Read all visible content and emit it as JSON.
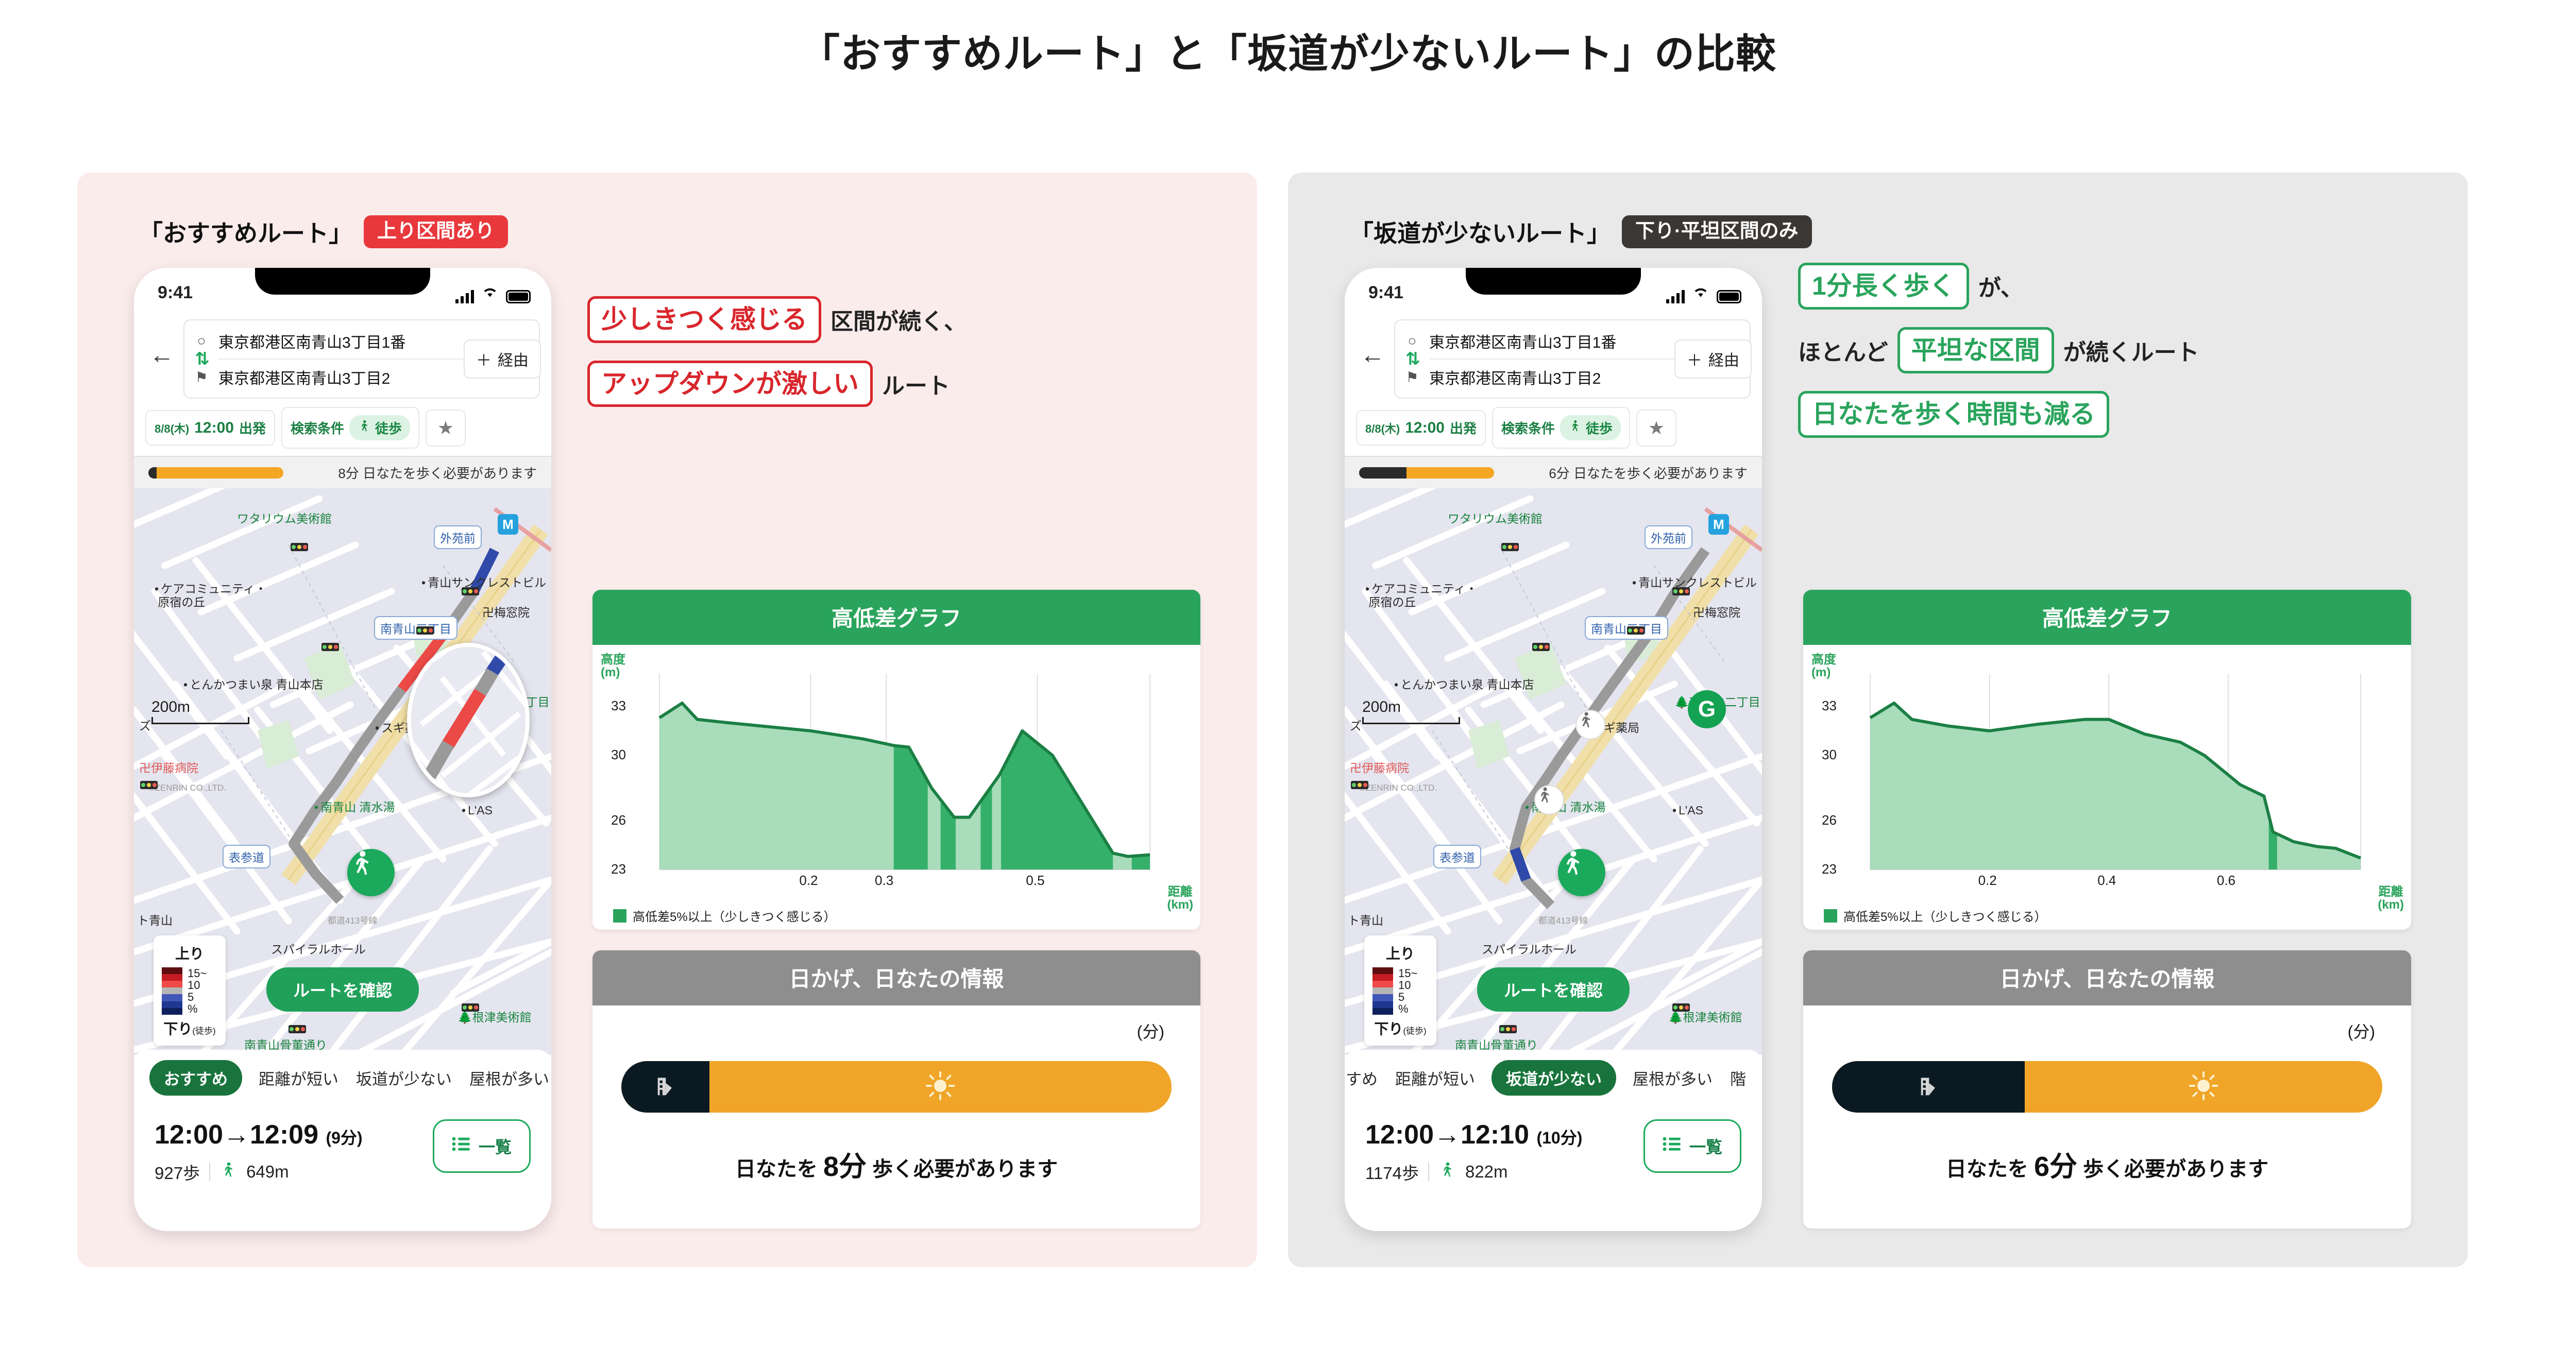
{
  "page_title": "「おすすめルート」と「坂道が少ないルート」の比較",
  "panels": [
    {
      "route_name": "「おすすめルート」",
      "badge": "上り区間あり",
      "badge_color": "#e8383c",
      "phone": {
        "clock": "9:41",
        "origin": "東京都港区南青山3丁目1番",
        "destination": "東京都港区南青山3丁目2",
        "via_label": "経由",
        "depart_date": "8/8(木)",
        "depart_time": "12:00",
        "depart_suffix": "出発",
        "search_cond_label": "検索条件",
        "mode_label": "徒歩",
        "sun_strip_text": "8分 日なたを歩く必要があります",
        "sun_strip_shade_pct": 6,
        "scale_label": "200m",
        "confirm_button": "ルートを確認",
        "map_labels": [
          "ワタリウム美術館",
          "外苑前",
          "青山サンクレストビル",
          "梅窓院",
          "ケアコミュニティ・",
          "原宿の丘",
          "南青山三丁目",
          "とんかつまい泉 青山本店",
          "スギ薬局",
          "南青山 清水湯",
          "伊藤病院",
          "表参道",
          "スパイラルホール",
          "ト青山",
          "南青山骨董通り",
          "根津美術館",
          "L'AS",
          "ズ",
          "©ZENRIN CO.,LTD.",
          "都道413号線",
          "南青山二丁目"
        ],
        "slope_legend": {
          "up": "上り",
          "down": "下り",
          "down_note": "(徒歩)",
          "ticks": [
            "15~",
            "10",
            "5",
            "%"
          ],
          "colors": [
            "#5e0d11",
            "#c41c22",
            "#ef4a47",
            "#b5b5b5",
            "#4157b8",
            "#1f3790",
            "#0d1f5c"
          ]
        },
        "tabs": [
          {
            "label": "おすすめ",
            "active": true
          },
          {
            "label": "距離が短い",
            "active": false
          },
          {
            "label": "坂道が少ない",
            "active": false
          },
          {
            "label": "屋根が多い",
            "active": false
          }
        ],
        "time_start": "12:00",
        "time_arrow": "→",
        "time_end": "12:09",
        "duration": "(9分)",
        "steps": "927歩",
        "distance": "649m",
        "list_button": "一覧"
      },
      "annotations": [
        {
          "highlight": "少しきつく感じる",
          "tail": "区間が続く、",
          "color": "red"
        },
        {
          "highlight": "アップダウンが激しい",
          "tail": "ルート",
          "color": "red"
        }
      ],
      "chart_card_title": "高低差グラフ",
      "sun_card_title": "日かげ、日なたの情報",
      "sun_unit": "(分)",
      "sun_shade_pct": 16,
      "sun_caption_pre": "日なたを",
      "sun_caption_value": "8分",
      "sun_caption_post": "歩く必要があります"
    },
    {
      "route_name": "「坂道が少ないルート」",
      "badge": "下り·平坦区間のみ",
      "badge_color": "#3b3734",
      "phone": {
        "clock": "9:41",
        "origin": "東京都港区南青山3丁目1番",
        "destination": "東京都港区南青山3丁目2",
        "via_label": "経由",
        "depart_date": "8/8(木)",
        "depart_time": "12:00",
        "depart_suffix": "出発",
        "search_cond_label": "検索条件",
        "mode_label": "徒歩",
        "sun_strip_text": "6分 日なたを歩く必要があります",
        "sun_strip_shade_pct": 35,
        "scale_label": "200m",
        "confirm_button": "ルートを確認",
        "map_labels": [
          "ワタリウム美術館",
          "外苑前",
          "青山サンクレストビル",
          "梅窓院",
          "ケアコミュニティ・",
          "原宿の丘",
          "南青山三丁目",
          "とんかつまい泉 青山本店",
          "スギ薬局",
          "南青山 清水湯",
          "伊藤病院",
          "表参道",
          "スパイラルホール",
          "ト青山",
          "南青山骨董通り",
          "根津美術館",
          "L'AS",
          "ズ",
          "©ZENRIN CO.,LTD.",
          "都道413号線",
          "南青山二丁目"
        ],
        "slope_legend": {
          "up": "上り",
          "down": "下り",
          "down_note": "(徒歩)",
          "ticks": [
            "15~",
            "10",
            "5",
            "%"
          ],
          "colors": [
            "#5e0d11",
            "#c41c22",
            "#ef4a47",
            "#b5b5b5",
            "#4157b8",
            "#1f3790",
            "#0d1f5c"
          ]
        },
        "tabs": [
          {
            "label": "すめ",
            "active": false
          },
          {
            "label": "距離が短い",
            "active": false
          },
          {
            "label": "坂道が少ない",
            "active": true
          },
          {
            "label": "屋根が多い",
            "active": false
          },
          {
            "label": "階",
            "active": false
          }
        ],
        "time_start": "12:00",
        "time_arrow": "→",
        "time_end": "12:10",
        "duration": "(10分)",
        "steps": "1174歩",
        "distance": "822m",
        "list_button": "一覧"
      },
      "annotations": [
        {
          "highlight": "1分長く歩く",
          "tail": "が、",
          "color": "green"
        },
        {
          "lead": "ほとんど",
          "highlight": "平坦な区間",
          "tail": "が続くルート",
          "color": "green"
        },
        {
          "highlight": "日なたを歩く時間も減る",
          "tail": "",
          "color": "green"
        }
      ],
      "chart_card_title": "高低差グラフ",
      "sun_card_title": "日かげ、日なたの情報",
      "sun_unit": "(分)",
      "sun_shade_pct": 35,
      "sun_caption_pre": "日なたを",
      "sun_caption_value": "6分",
      "sun_caption_post": "歩く必要があります"
    }
  ],
  "chart_data": [
    {
      "type": "area",
      "title": "高低差グラフ",
      "xlabel": "距離",
      "xunit": "(km)",
      "ylabel": "高度",
      "yunit": "(m)",
      "ylim": [
        23,
        35
      ],
      "xlim": [
        0,
        0.649
      ],
      "yticks": [
        33,
        30,
        26,
        23
      ],
      "xticks": [
        0.2,
        0.3,
        0.5
      ],
      "grid": true,
      "legend": "高低差5%以上（少しきつく感じる）",
      "legend_color": "#2aa45c",
      "fill_light": "#a8dcba",
      "fill_dark": "#35b06a",
      "line_color": "#1b7f43",
      "x": [
        0.0,
        0.03,
        0.05,
        0.09,
        0.2,
        0.27,
        0.31,
        0.33,
        0.36,
        0.39,
        0.41,
        0.45,
        0.48,
        0.52,
        0.56,
        0.6,
        0.62,
        0.649
      ],
      "y": [
        32.3,
        33.2,
        32.2,
        32.0,
        31.5,
        31.0,
        30.6,
        30.5,
        28.0,
        26.2,
        26.2,
        28.8,
        31.5,
        30.0,
        27.0,
        24.0,
        23.8,
        23.9
      ],
      "steep_segments": [
        [
          0.31,
          0.649
        ]
      ],
      "steep_note": "dark band = gradient ≥5%"
    },
    {
      "type": "area",
      "title": "高低差グラフ",
      "xlabel": "距離",
      "xunit": "(km)",
      "ylabel": "高度",
      "yunit": "(m)",
      "ylim": [
        23,
        35
      ],
      "xlim": [
        0,
        0.822
      ],
      "yticks": [
        33,
        30,
        26,
        23
      ],
      "xticks": [
        0.2,
        0.4,
        0.6
      ],
      "grid": true,
      "legend": "高低差5%以上（少しきつく感じる）",
      "legend_color": "#2aa45c",
      "fill_light": "#a8dcba",
      "fill_dark": "#35b06a",
      "line_color": "#1b7f43",
      "x": [
        0.0,
        0.04,
        0.07,
        0.13,
        0.2,
        0.28,
        0.36,
        0.4,
        0.46,
        0.52,
        0.56,
        0.62,
        0.66,
        0.675,
        0.71,
        0.75,
        0.78,
        0.822
      ],
      "y": [
        32.3,
        33.2,
        32.2,
        31.8,
        31.5,
        31.9,
        32.2,
        32.2,
        31.3,
        30.8,
        30.0,
        28.2,
        27.5,
        25.3,
        24.7,
        24.4,
        24.3,
        23.7
      ],
      "steep_segments": [
        [
          0.668,
          0.682
        ]
      ],
      "steep_note": "single narrow dark band"
    }
  ]
}
